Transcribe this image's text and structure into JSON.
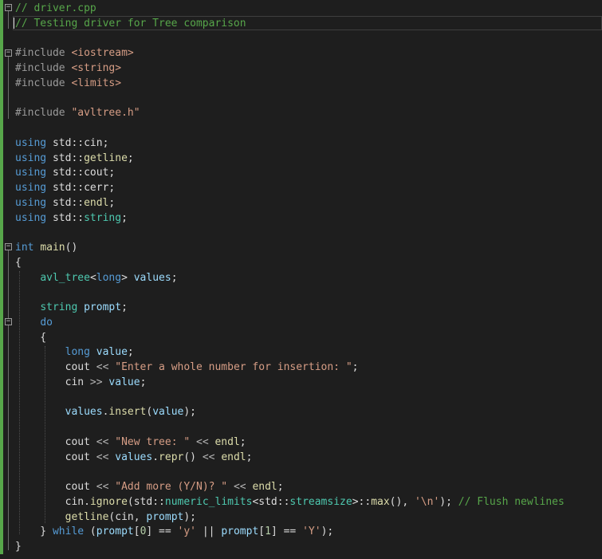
{
  "editor": {
    "lines": [
      [
        {
          "t": "// driver.cpp",
          "c": "comment"
        }
      ],
      [
        {
          "t": "// Testing driver for Tree comparison",
          "c": "comment"
        }
      ],
      [],
      [
        {
          "t": "#include ",
          "c": "preproc"
        },
        {
          "t": "<iostream>",
          "c": "string"
        }
      ],
      [
        {
          "t": "#include ",
          "c": "preproc"
        },
        {
          "t": "<string>",
          "c": "string"
        }
      ],
      [
        {
          "t": "#include ",
          "c": "preproc"
        },
        {
          "t": "<limits>",
          "c": "string"
        }
      ],
      [],
      [
        {
          "t": "#include ",
          "c": "preproc"
        },
        {
          "t": "\"avltree.h\"",
          "c": "string"
        }
      ],
      [],
      [
        {
          "t": "using",
          "c": "keyword"
        },
        {
          "t": " std::",
          "c": "plain"
        },
        {
          "t": "cin",
          "c": "plain"
        },
        {
          "t": ";",
          "c": "plain"
        }
      ],
      [
        {
          "t": "using",
          "c": "keyword"
        },
        {
          "t": " std::",
          "c": "plain"
        },
        {
          "t": "getline",
          "c": "func"
        },
        {
          "t": ";",
          "c": "plain"
        }
      ],
      [
        {
          "t": "using",
          "c": "keyword"
        },
        {
          "t": " std::",
          "c": "plain"
        },
        {
          "t": "cout",
          "c": "plain"
        },
        {
          "t": ";",
          "c": "plain"
        }
      ],
      [
        {
          "t": "using",
          "c": "keyword"
        },
        {
          "t": " std::",
          "c": "plain"
        },
        {
          "t": "cerr",
          "c": "plain"
        },
        {
          "t": ";",
          "c": "plain"
        }
      ],
      [
        {
          "t": "using",
          "c": "keyword"
        },
        {
          "t": " std::",
          "c": "plain"
        },
        {
          "t": "endl",
          "c": "func"
        },
        {
          "t": ";",
          "c": "plain"
        }
      ],
      [
        {
          "t": "using",
          "c": "keyword"
        },
        {
          "t": " std::",
          "c": "plain"
        },
        {
          "t": "string",
          "c": "type"
        },
        {
          "t": ";",
          "c": "plain"
        }
      ],
      [],
      [
        {
          "t": "int",
          "c": "keyword"
        },
        {
          "t": " ",
          "c": "plain"
        },
        {
          "t": "main",
          "c": "func"
        },
        {
          "t": "()",
          "c": "plain"
        }
      ],
      [
        {
          "t": "{",
          "c": "plain"
        }
      ],
      [
        {
          "t": "    ",
          "c": "plain"
        },
        {
          "t": "avl_tree",
          "c": "type"
        },
        {
          "t": "<",
          "c": "plain"
        },
        {
          "t": "long",
          "c": "keyword"
        },
        {
          "t": "> ",
          "c": "plain"
        },
        {
          "t": "values",
          "c": "var"
        },
        {
          "t": ";",
          "c": "plain"
        }
      ],
      [],
      [
        {
          "t": "    ",
          "c": "plain"
        },
        {
          "t": "string",
          "c": "type"
        },
        {
          "t": " ",
          "c": "plain"
        },
        {
          "t": "prompt",
          "c": "var"
        },
        {
          "t": ";",
          "c": "plain"
        }
      ],
      [
        {
          "t": "    ",
          "c": "plain"
        },
        {
          "t": "do",
          "c": "keyword"
        }
      ],
      [
        {
          "t": "    {",
          "c": "plain"
        }
      ],
      [
        {
          "t": "        ",
          "c": "plain"
        },
        {
          "t": "long",
          "c": "keyword"
        },
        {
          "t": " ",
          "c": "plain"
        },
        {
          "t": "value",
          "c": "var"
        },
        {
          "t": ";",
          "c": "plain"
        }
      ],
      [
        {
          "t": "        ",
          "c": "plain"
        },
        {
          "t": "cout",
          "c": "plain"
        },
        {
          "t": " << ",
          "c": "op"
        },
        {
          "t": "\"Enter a whole number for insertion: \"",
          "c": "string"
        },
        {
          "t": ";",
          "c": "plain"
        }
      ],
      [
        {
          "t": "        ",
          "c": "plain"
        },
        {
          "t": "cin",
          "c": "plain"
        },
        {
          "t": " >> ",
          "c": "op"
        },
        {
          "t": "value",
          "c": "var"
        },
        {
          "t": ";",
          "c": "plain"
        }
      ],
      [],
      [
        {
          "t": "        ",
          "c": "plain"
        },
        {
          "t": "values",
          "c": "var"
        },
        {
          "t": ".",
          "c": "plain"
        },
        {
          "t": "insert",
          "c": "func"
        },
        {
          "t": "(",
          "c": "plain"
        },
        {
          "t": "value",
          "c": "var"
        },
        {
          "t": ");",
          "c": "plain"
        }
      ],
      [],
      [
        {
          "t": "        ",
          "c": "plain"
        },
        {
          "t": "cout",
          "c": "plain"
        },
        {
          "t": " << ",
          "c": "op"
        },
        {
          "t": "\"New tree: \"",
          "c": "string"
        },
        {
          "t": " << ",
          "c": "op"
        },
        {
          "t": "endl",
          "c": "func"
        },
        {
          "t": ";",
          "c": "plain"
        }
      ],
      [
        {
          "t": "        ",
          "c": "plain"
        },
        {
          "t": "cout",
          "c": "plain"
        },
        {
          "t": " << ",
          "c": "op"
        },
        {
          "t": "values",
          "c": "var"
        },
        {
          "t": ".",
          "c": "plain"
        },
        {
          "t": "repr",
          "c": "func"
        },
        {
          "t": "() ",
          "c": "plain"
        },
        {
          "t": "<< ",
          "c": "op"
        },
        {
          "t": "endl",
          "c": "func"
        },
        {
          "t": ";",
          "c": "plain"
        }
      ],
      [],
      [
        {
          "t": "        ",
          "c": "plain"
        },
        {
          "t": "cout",
          "c": "plain"
        },
        {
          "t": " << ",
          "c": "op"
        },
        {
          "t": "\"Add more (Y/N)? \"",
          "c": "string"
        },
        {
          "t": " << ",
          "c": "op"
        },
        {
          "t": "endl",
          "c": "func"
        },
        {
          "t": ";",
          "c": "plain"
        }
      ],
      [
        {
          "t": "        ",
          "c": "plain"
        },
        {
          "t": "cin",
          "c": "plain"
        },
        {
          "t": ".",
          "c": "plain"
        },
        {
          "t": "ignore",
          "c": "func"
        },
        {
          "t": "(std::",
          "c": "plain"
        },
        {
          "t": "numeric_limits",
          "c": "type"
        },
        {
          "t": "<std::",
          "c": "plain"
        },
        {
          "t": "streamsize",
          "c": "type"
        },
        {
          "t": ">::",
          "c": "plain"
        },
        {
          "t": "max",
          "c": "func"
        },
        {
          "t": "(), ",
          "c": "plain"
        },
        {
          "t": "'\\n'",
          "c": "string"
        },
        {
          "t": "); ",
          "c": "plain"
        },
        {
          "t": "// Flush newlines",
          "c": "comment"
        }
      ],
      [
        {
          "t": "        ",
          "c": "plain"
        },
        {
          "t": "getline",
          "c": "func"
        },
        {
          "t": "(",
          "c": "plain"
        },
        {
          "t": "cin",
          "c": "plain"
        },
        {
          "t": ", ",
          "c": "plain"
        },
        {
          "t": "prompt",
          "c": "var"
        },
        {
          "t": ");",
          "c": "plain"
        }
      ],
      [
        {
          "t": "    } ",
          "c": "plain"
        },
        {
          "t": "while",
          "c": "keyword"
        },
        {
          "t": " (",
          "c": "plain"
        },
        {
          "t": "prompt",
          "c": "var"
        },
        {
          "t": "[",
          "c": "plain"
        },
        {
          "t": "0",
          "c": "num"
        },
        {
          "t": "] == ",
          "c": "plain"
        },
        {
          "t": "'y'",
          "c": "string"
        },
        {
          "t": " || ",
          "c": "plain"
        },
        {
          "t": "prompt",
          "c": "var"
        },
        {
          "t": "[",
          "c": "plain"
        },
        {
          "t": "1",
          "c": "num"
        },
        {
          "t": "] == ",
          "c": "plain"
        },
        {
          "t": "'Y'",
          "c": "string"
        },
        {
          "t": ");",
          "c": "plain"
        }
      ],
      [
        {
          "t": "}",
          "c": "plain"
        }
      ]
    ],
    "colors": {
      "background": "#1e1e1e",
      "comment": "#57a64a",
      "keyword": "#569cd6",
      "string": "#d69d85",
      "type": "#4ec9b0",
      "variable": "#9cdcfe",
      "function": "#dcdcaa",
      "plain": "#dcdcdc"
    }
  }
}
